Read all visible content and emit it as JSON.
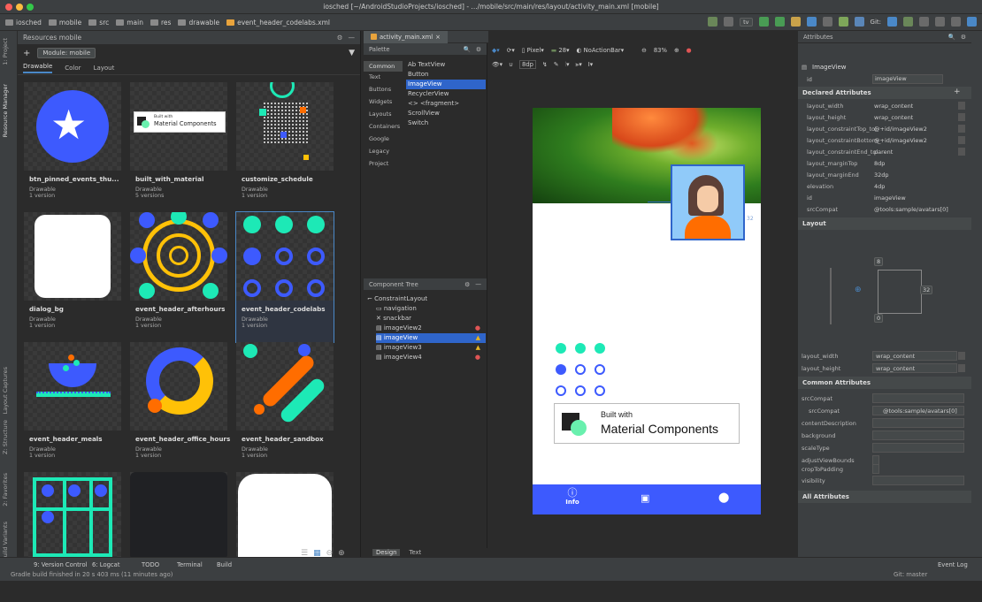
{
  "window": {
    "title": "iosched [~/AndroidStudioProjects/iosched] - .../mobile/src/main/res/layout/activity_main.xml [mobile]"
  },
  "breadcrumbs": [
    "iosched",
    "mobile",
    "src",
    "main",
    "res",
    "drawable",
    "event_header_codelabs.xml"
  ],
  "toolbar": {
    "run_config": "tv",
    "git_label": "Git:"
  },
  "resources": {
    "header": "Resources",
    "header_module": "mobile",
    "module_select": "Module: mobile",
    "tabs": [
      "Drawable",
      "Color",
      "Layout"
    ],
    "items": [
      {
        "name": "btn_pinned_events_thu...",
        "type": "Drawable",
        "version": "1 version"
      },
      {
        "name": "built_with_material",
        "type": "Drawable",
        "version": "5 versions"
      },
      {
        "name": "customize_schedule",
        "type": "Drawable",
        "version": "1 version"
      },
      {
        "name": "dialog_bg",
        "type": "Drawable",
        "version": "1 version"
      },
      {
        "name": "event_header_afterhours",
        "type": "Drawable",
        "version": "1 version"
      },
      {
        "name": "event_header_codelabs",
        "type": "Drawable",
        "version": "1 version"
      },
      {
        "name": "event_header_meals",
        "type": "Drawable",
        "version": "1 version"
      },
      {
        "name": "event_header_office_hours",
        "type": "Drawable",
        "version": "1 version"
      },
      {
        "name": "event_header_sandbox",
        "type": "Drawable",
        "version": "1 version"
      }
    ],
    "built_with_small": "Built with",
    "material_components_small": "Material Components"
  },
  "editor_tab": "activity_main.xml",
  "palette": {
    "header": "Palette",
    "categories": [
      "Common",
      "Text",
      "Buttons",
      "Widgets",
      "Layouts",
      "Containers",
      "Google",
      "Legacy",
      "Project"
    ],
    "items": [
      "Ab TextView",
      "Button",
      "ImageView",
      "RecyclerView",
      "<> <fragment>",
      "ScrollView",
      "Switch"
    ]
  },
  "design_toolbar": {
    "device": "Pixel",
    "api": "28",
    "theme": "NoActionBar",
    "zoom": "83%",
    "margin": "8dp"
  },
  "component_tree": {
    "header": "Component Tree",
    "items": [
      "ConstraintLayout",
      "navigation",
      "snackbar",
      "imageView2",
      "imageView",
      "imageView3",
      "imageView4"
    ]
  },
  "phone": {
    "built_with": "Built with",
    "material_components": "Material Components",
    "nav_label": "Info",
    "margin_label": "32"
  },
  "attributes": {
    "header": "Attributes",
    "widget": "ImageView",
    "id_label": "id",
    "id_value": "imageView",
    "declared_header": "Declared Attributes",
    "declared": [
      [
        "layout_width",
        "wrap_content"
      ],
      [
        "layout_height",
        "wrap_content"
      ],
      [
        "layout_constraintTop_tol",
        "@+id/imageView2"
      ],
      [
        "layout_constraintBottom_",
        "@+id/imageView2"
      ],
      [
        "layout_constraintEnd_tol",
        "parent"
      ],
      [
        "layout_marginTop",
        "8dp"
      ],
      [
        "layout_marginEnd",
        "32dp"
      ],
      [
        "elevation",
        "4dp"
      ],
      [
        "id",
        "imageView"
      ],
      [
        "srcCompat",
        "@tools:sample/avatars[0]"
      ]
    ],
    "layout_header": "Layout",
    "constraint_top": "8",
    "constraint_right": "32",
    "constraint_bottom": "0",
    "layout_width_label": "layout_width",
    "layout_width_value": "wrap_content",
    "layout_height_label": "layout_height",
    "layout_height_value": "wrap_content",
    "common_header": "Common Attributes",
    "common": [
      [
        "srcCompat",
        ""
      ],
      [
        "srcCompat",
        "@tools:sample/avatars[0]"
      ],
      [
        "contentDescription",
        ""
      ],
      [
        "background",
        ""
      ],
      [
        "scaleType",
        ""
      ],
      [
        "adjustViewBounds",
        ""
      ],
      [
        "cropToPadding",
        ""
      ],
      [
        "visibility",
        ""
      ]
    ],
    "all_header": "All Attributes"
  },
  "bottom_tabs": {
    "design": "Design",
    "text": "Text"
  },
  "statusbar": {
    "tools": [
      "9: Version Control",
      "6: Logcat",
      "TODO",
      "Terminal",
      "Build"
    ],
    "event_log": "Event Log",
    "message": "Gradle build finished in 20 s 403 ms (11 minutes ago)",
    "git": "Git: master"
  },
  "colors": {
    "accent": "#4a88c7",
    "selection": "#2f65ca",
    "material_blue": "#3d5afe",
    "teal": "#1de9b6",
    "yellow": "#ffc107",
    "orange": "#ff6d00"
  }
}
